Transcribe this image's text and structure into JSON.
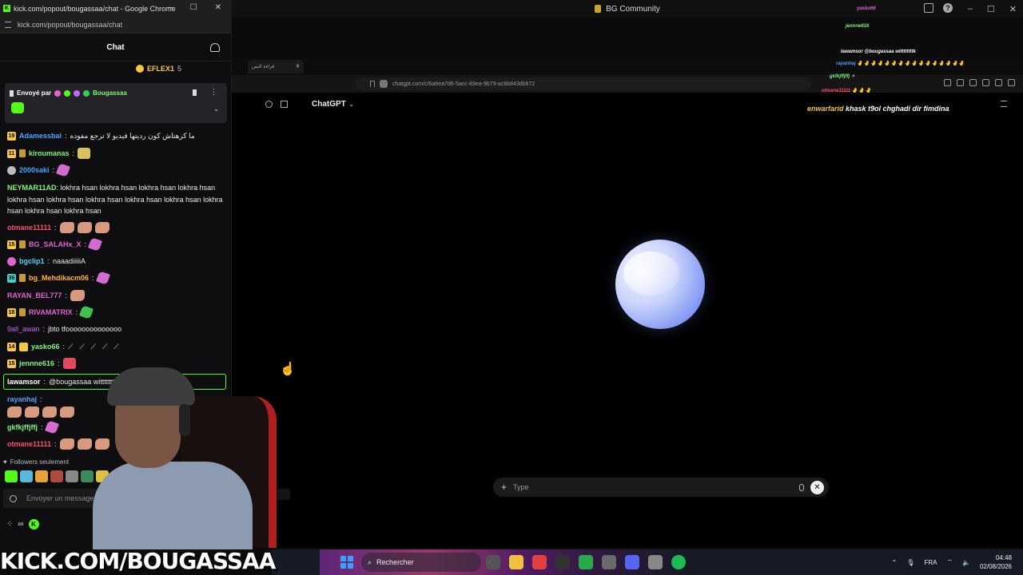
{
  "host_window": {
    "title": "BG Community",
    "ctrl_min": "–",
    "ctrl_max": "☐",
    "ctrl_close": "✕"
  },
  "inner_browser": {
    "tab_label": "قراءة النص",
    "tab_close": "✕",
    "newtab": "+",
    "url": "chatgpt.com/c/6a6ea7d6-5acc-83ea-9b79-ac8b843db872",
    "model_label": "ChatGPT",
    "model_chevron": "⌄",
    "input_placeholder": "Type",
    "input_plus": "+",
    "close_glyph": "✕"
  },
  "overlay_chat": [
    {
      "user": "rayanhaj",
      "text": "🤚🤚🤚🤚🤚🤚🤚🤚🤚🤚🤚🤚🤚🤚🤚🤚"
    },
    {
      "user": "gkfkjffjffj",
      "text": ""
    },
    {
      "user": "otmane11111",
      "text": "🤚🤚🤚"
    },
    {
      "user": "enwarfarid",
      "text": "khask t9ol chghadi dir fimdina"
    },
    {
      "user": "lawamsor",
      "text": "@bougassaa wittttttttk"
    },
    {
      "user": "jennne616",
      "text": ""
    },
    {
      "user": "yasko66",
      "text": ""
    }
  ],
  "chat_window": {
    "title": "kick.com/popout/bougassaa/chat - Google Chrome",
    "url": "kick.com/popout/bougassaa/chat",
    "header": "Chat",
    "gifter": "EFLEX1",
    "gift_count": "5",
    "pinned_label": "Envoyé par",
    "pinned_user": "Bougassaa",
    "messages": [
      {
        "badge": "19",
        "user": "Adamessbai",
        "color": "#4aa3ff",
        "text": "ما كرهتاش كون رديتها فيديو لا ترجع مفوده"
      },
      {
        "badge": "11",
        "user": "kiroumanas",
        "color": "#7ef57a",
        "text": ""
      },
      {
        "badge": "",
        "user": "2000saki",
        "color": "#4aa3ff",
        "text": ""
      },
      {
        "badge": "",
        "user": "otmane11111",
        "color": "#ff4d6a",
        "text": ""
      },
      {
        "badge": "15",
        "user": "BG_SALAHx_X",
        "color": "#e063d0",
        "text": ""
      },
      {
        "badge": "",
        "user": "bgclip1",
        "color": "#4ad9ff",
        "text": "naaadiiiiiA"
      },
      {
        "badge": "36",
        "user": "bg_Mehdikacm06",
        "color": "#ffb340",
        "text": ""
      },
      {
        "badge": "",
        "user": "RAYAN_BEL777",
        "color": "#e063d0",
        "text": ""
      },
      {
        "badge": "18",
        "user": "RIVAMATRIX",
        "color": "#e063d0",
        "text": ""
      },
      {
        "badge": "",
        "user": "9all_awan",
        "color": "#c06bff",
        "text": "jbto tfoooooooooooooo"
      },
      {
        "badge": "14",
        "user": "yasko66",
        "color": "#7ef57a",
        "text": ""
      },
      {
        "badge": "15",
        "user": "jennne616",
        "color": "#7ef57a",
        "text": ""
      },
      {
        "badge": "",
        "user": "lawamsor",
        "color": "#ffffff",
        "text": "@bougassaa wittttttt"
      },
      {
        "badge": "",
        "user": "rayanhaj",
        "color": "#4aa3ff",
        "text": ""
      },
      {
        "badge": "",
        "user": "gkfkjffjffj",
        "color": "#7ef57a",
        "text": ""
      },
      {
        "badge": "",
        "user": "otmane11111",
        "color": "#ff4d6a",
        "text": ""
      }
    ],
    "neymar": {
      "user": "NEYMAR11AD",
      "text": "lokhra hsan lokhra hsan lokhra hsan lokhra hsan lokhra hsan lokhra hsan lokhra hsan lokhra hsan lokhra hsan lokhra hsan lokhra hsan lokhra hsan"
    },
    "followers_only": "Followers seulement",
    "input_placeholder": "Envoyer un message"
  },
  "watermark": "KICK.COM/BOUGASSAA",
  "taskbar": {
    "search_label": "Rechercher",
    "lang": "FRA",
    "time": "04:48",
    "date": "02/08/2026"
  }
}
